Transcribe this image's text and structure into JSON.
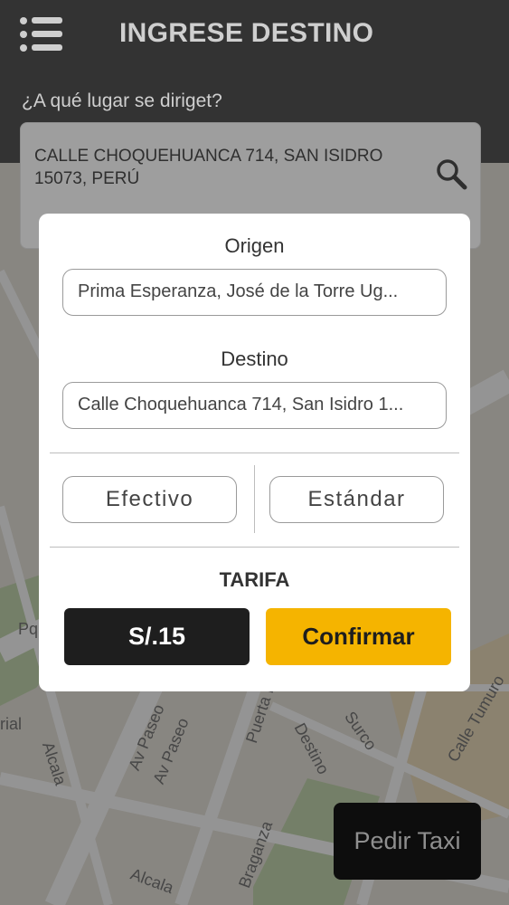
{
  "header": {
    "menu_icon": "menu-icon",
    "title": "INGRESE DESTINO",
    "subtitle": "¿A qué lugar se diriget?",
    "search_value": "CALLE CHOQUEHUANCA 714, SAN ISIDRO 15073, PERÚ",
    "search_icon": "search-icon"
  },
  "map": {
    "labels": [
      "Alcala",
      "Av Paseo",
      "Av Paseo",
      "Puerta D...",
      "Surco",
      "Destino",
      "Calle Tumuro",
      "Braganza",
      "Alcala",
      "Pq",
      "rial"
    ]
  },
  "dialog": {
    "origin_label": "Origen",
    "origin_value": "Prima Esperanza, José de la Torre Ug...",
    "destination_label": "Destino",
    "destination_value": "Calle Choquehuanca 714, San Isidro 1...",
    "payment_option": "Efectivo",
    "service_option": "Estándar",
    "fare_label": "TARIFA",
    "fare_value": "S/.15",
    "confirm_label": "Confirmar"
  },
  "taxi_button": {
    "label": "Pedir Taxi"
  },
  "colors": {
    "header_bg": "#333333",
    "accent": "#f5b400",
    "dark": "#1e1e1e"
  }
}
